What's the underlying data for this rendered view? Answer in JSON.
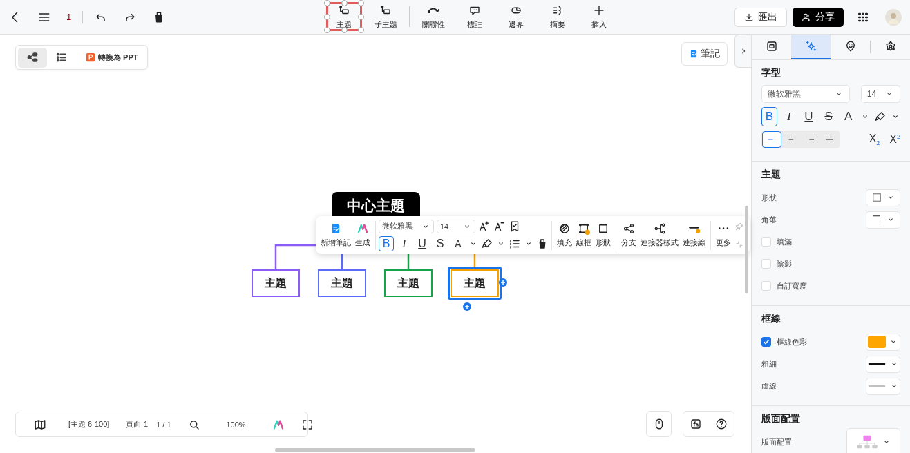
{
  "top_bar": {
    "page_number": "1",
    "tools": [
      {
        "kind": "topic",
        "label": "主題",
        "selected": true
      },
      {
        "kind": "subtopic",
        "label": "子主題",
        "selected": false
      },
      {
        "kind": "relation",
        "label": "關聯性",
        "selected": false
      },
      {
        "kind": "callout",
        "label": "標註",
        "selected": false
      },
      {
        "kind": "boundary",
        "label": "邊界",
        "selected": false
      },
      {
        "kind": "summary",
        "label": "摘要",
        "selected": false
      },
      {
        "kind": "insert",
        "label": "插入",
        "selected": false
      }
    ],
    "export": "匯出",
    "share": "分享"
  },
  "view_switcher": {
    "modes": [
      {
        "kind": "map",
        "selected": true
      },
      {
        "kind": "outline",
        "selected": false
      }
    ],
    "convert": "轉換為 PPT"
  },
  "notes_button": "筆記",
  "mindmap": {
    "central": "中心主題",
    "topics": [
      {
        "label": "主題",
        "color": "#8b5cf6",
        "selected": false
      },
      {
        "label": "主題",
        "color": "#5b6cf9",
        "selected": false
      },
      {
        "label": "主題",
        "color": "#16a34a",
        "selected": false
      },
      {
        "label": "主題",
        "color": "#f5a000",
        "selected": true
      }
    ]
  },
  "floating_toolbar": {
    "actions": [
      {
        "kind": "note",
        "label": "新增筆記"
      },
      {
        "kind": "ai",
        "label": "生成"
      }
    ],
    "font": "微软雅黑",
    "size": "14",
    "format": [
      {
        "kind": "bold",
        "label": "B",
        "selected": true
      },
      {
        "kind": "italic",
        "label": "I",
        "selected": false
      },
      {
        "kind": "underline",
        "label": "U",
        "selected": false
      },
      {
        "kind": "strike",
        "label": "S",
        "selected": false
      },
      {
        "kind": "color",
        "label": "A",
        "selected": false
      }
    ],
    "style": [
      {
        "kind": "fill",
        "label": "填充"
      },
      {
        "kind": "border",
        "label": "線框"
      },
      {
        "kind": "shape",
        "label": "形狀"
      },
      {
        "kind": "branch",
        "label": "分支"
      },
      {
        "kind": "connector",
        "label": "連接器樣式"
      },
      {
        "kind": "line",
        "label": "連接線"
      },
      {
        "kind": "more",
        "label": "更多"
      }
    ]
  },
  "side_panel": {
    "tabs": [
      {
        "kind": "style",
        "selected": false
      },
      {
        "kind": "sparkle",
        "selected": true
      },
      {
        "kind": "marker",
        "selected": false
      },
      {
        "kind": "flower",
        "selected": false
      }
    ],
    "font": {
      "title": "字型",
      "family": "微软雅黑",
      "size": "14",
      "format": [
        {
          "kind": "bold",
          "label": "B",
          "selected": true
        },
        {
          "kind": "italic",
          "label": "I",
          "selected": false
        },
        {
          "kind": "underline",
          "label": "U",
          "selected": false
        },
        {
          "kind": "strike",
          "label": "S",
          "selected": false
        },
        {
          "kind": "color",
          "label": "A",
          "selected": false
        }
      ],
      "align": [
        {
          "kind": "left",
          "selected": true
        },
        {
          "kind": "center",
          "selected": false
        },
        {
          "kind": "right",
          "selected": false
        },
        {
          "kind": "justify",
          "selected": false
        }
      ],
      "scripts": [
        "X$_{2}$",
        "X$^{2}$"
      ]
    },
    "sections": [
      {
        "title": "主題",
        "rows": [
          {
            "kind": "shape",
            "label": "形狀"
          },
          {
            "kind": "corner",
            "label": "角落"
          },
          {
            "kind": "checkbox",
            "label": "填滿",
            "checked": false
          },
          {
            "kind": "checkbox",
            "label": "陰影",
            "checked": false
          },
          {
            "kind": "checkbox",
            "label": "自訂寬度",
            "checked": false
          }
        ]
      },
      {
        "title": "框線",
        "rows": [
          {
            "kind": "color",
            "label": "框線色彩",
            "checked": true,
            "color": "#ffa500"
          },
          {
            "kind": "thickness",
            "label": "粗細"
          },
          {
            "kind": "dash",
            "label": "虛線"
          }
        ]
      },
      {
        "title": "版面配置",
        "rows": [
          {
            "kind": "layout",
            "label": "版面配置"
          }
        ]
      }
    ]
  },
  "bottom_bar": {
    "topic_range": "[主題 6-100]",
    "page": "頁面-1",
    "page_count": "1 / 1",
    "zoom": "100%"
  }
}
